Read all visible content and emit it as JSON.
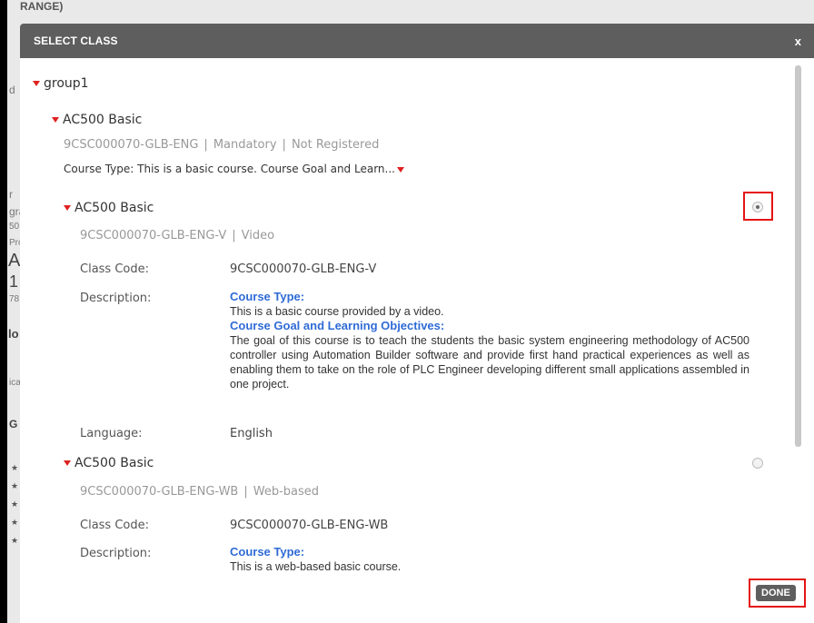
{
  "background": {
    "fragments": [
      "RANGE)",
      "d",
      "r",
      "gra",
      "50",
      "Pro",
      "A",
      "1",
      "78",
      "lo",
      "ica",
      "G"
    ]
  },
  "modal": {
    "title": "SELECT CLASS",
    "close_label": "x",
    "group": {
      "label": "group1",
      "course": {
        "title": "AC500 Basic",
        "code": "9CSC000070-GLB-ENG",
        "requirement": "Mandatory",
        "status": "Not Registered",
        "course_type_line": "Course Type: This is a basic course. Course Goal and Learn...",
        "classes": [
          {
            "title": "AC500 Basic",
            "code": "9CSC000070-GLB-ENG-V",
            "delivery": "Video",
            "selected": true,
            "class_code_label": "Class Code:",
            "class_code_value": "9CSC000070-GLB-ENG-V",
            "description_label": "Description:",
            "course_type_heading": "Course Type:",
            "course_type_text": "This is a basic course provided by a video.",
            "goals_heading": "Course Goal and Learning Objectives:",
            "goals_text": "The goal of this course is to teach the students the basic system engineering methodology of AC500 controller using Automation Builder software and provide first hand practical experiences as well as enabling them to take on the role of PLC Engineer developing different small applications assembled in one project.",
            "language_label": "Language:",
            "language_value": "English"
          },
          {
            "title": "AC500 Basic",
            "code": "9CSC000070-GLB-ENG-WB",
            "delivery": "Web-based",
            "selected": false,
            "class_code_label": "Class Code:",
            "class_code_value": "9CSC000070-GLB-ENG-WB",
            "description_label": "Description:",
            "course_type_heading": "Course Type:",
            "course_type_text": "This is a web-based basic course."
          }
        ]
      }
    },
    "done_label": "DONE"
  },
  "colors": {
    "header_bg": "#5e5e5e",
    "accent_red": "#e02020",
    "link_blue": "#2f6bd6",
    "highlight_red": "#e41414"
  }
}
